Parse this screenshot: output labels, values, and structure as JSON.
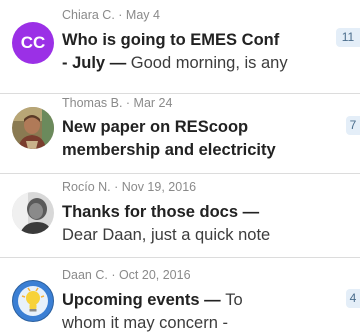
{
  "threads": [
    {
      "author_date": "Chiara C. · May 4",
      "avatar": {
        "type": "initials",
        "initials": "CC",
        "color": "#9b30e6"
      },
      "subject_line1": "Who is going to EMES Conf",
      "subject_line2": "- July",
      "separator": " — ",
      "preview_line1": "",
      "preview_line2": "Good morning, is any",
      "count": "11"
    },
    {
      "author_date": "Thomas B. · Mar 24",
      "avatar": {
        "type": "photo",
        "icon": "user-photo-icon"
      },
      "subject_line1": "New paper on REScoop",
      "subject_line2": "membership and electricity",
      "separator": "",
      "preview_line1": "",
      "preview_line2": "",
      "count": "7"
    },
    {
      "author_date": "Rocío N. · Nov 19, 2016",
      "avatar": {
        "type": "photo",
        "icon": "user-photo-icon"
      },
      "subject_line1": "Thanks for those docs",
      "subject_line2": "",
      "separator": " —",
      "preview_line1": "",
      "preview_line2": "Dear Daan, just a quick note",
      "count": ""
    },
    {
      "author_date": "Daan C. · Oct 20, 2016",
      "avatar": {
        "type": "icon",
        "icon": "lightbulb-icon"
      },
      "subject_line1": "Upcoming events",
      "subject_line2": "",
      "separator": " — ",
      "preview_line1": "To",
      "preview_line2": "whom it may concern -",
      "count": "4"
    }
  ]
}
